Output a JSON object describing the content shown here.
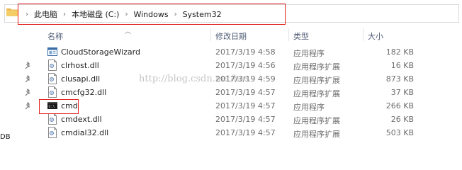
{
  "address": {
    "crumbs": [
      "此电脑",
      "本地磁盘 (C:)",
      "Windows",
      "System32"
    ],
    "separator": "›"
  },
  "columns": {
    "name": "名称",
    "date": "修改日期",
    "type": "类型",
    "size": "大小"
  },
  "files": [
    {
      "name": "CloudStorageWizard",
      "date": "2017/3/19 4:58",
      "type": "应用程序",
      "size": "182 KB",
      "icon": "app-window-icon",
      "pinned": false
    },
    {
      "name": "clrhost.dll",
      "date": "2017/3/19 4:56",
      "type": "应用程序扩展",
      "size": "16 KB",
      "icon": "dll-file-icon",
      "pinned": true
    },
    {
      "name": "clusapi.dll",
      "date": "2017/3/19 4:59",
      "type": "应用程序扩展",
      "size": "873 KB",
      "icon": "dll-file-icon",
      "pinned": true
    },
    {
      "name": "cmcfg32.dll",
      "date": "2017/3/19 4:57",
      "type": "应用程序扩展",
      "size": "37 KB",
      "icon": "dll-file-icon",
      "pinned": true
    },
    {
      "name": "cmd",
      "date": "2017/3/19 4:57",
      "type": "应用程序",
      "size": "266 KB",
      "icon": "console-icon",
      "pinned": true
    },
    {
      "name": "cmdext.dll",
      "date": "2017/3/19 4:57",
      "type": "应用程序扩展",
      "size": "26 KB",
      "icon": "dll-file-icon",
      "pinned": false
    },
    {
      "name": "cmdial32.dll",
      "date": "2017/3/19 4:57",
      "type": "应用程序扩展",
      "size": "503 KB",
      "icon": "dll-file-icon",
      "pinned": false
    }
  ],
  "watermark": "http://blog.csdn.net/hes",
  "left_fragment": "DB",
  "colors": {
    "highlight": "#e0211d",
    "header_text": "#4d5a73",
    "folder": "#e8b64b"
  }
}
